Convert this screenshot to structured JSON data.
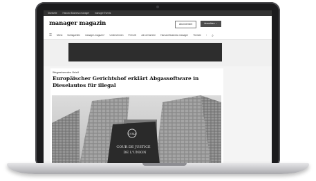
{
  "topbar": {
    "items": [
      "Startseite",
      "Harvard Business manager",
      "manager Events"
    ]
  },
  "header": {
    "logo": "manager magazin",
    "abo_label": "Abonnement",
    "login_label": "Anmelden"
  },
  "nav": {
    "menu_label": "Menü",
    "items": [
      "Schlagzeilen",
      "manager-magazin+",
      "Unternehmen",
      "FOCUS",
      "Job & Karriere",
      "Harvard Business manager",
      "Themen"
    ]
  },
  "article": {
    "kicker": "Wegweisendes Urteil",
    "headline": "Europäischer Gerichtshof erklärt Abgassoftware in Dieselautos für illegal",
    "image_sign_line1": "COUR DE JUSTICE",
    "image_sign_line2": "DE L'UNION",
    "image_seal": "CVRIA"
  }
}
